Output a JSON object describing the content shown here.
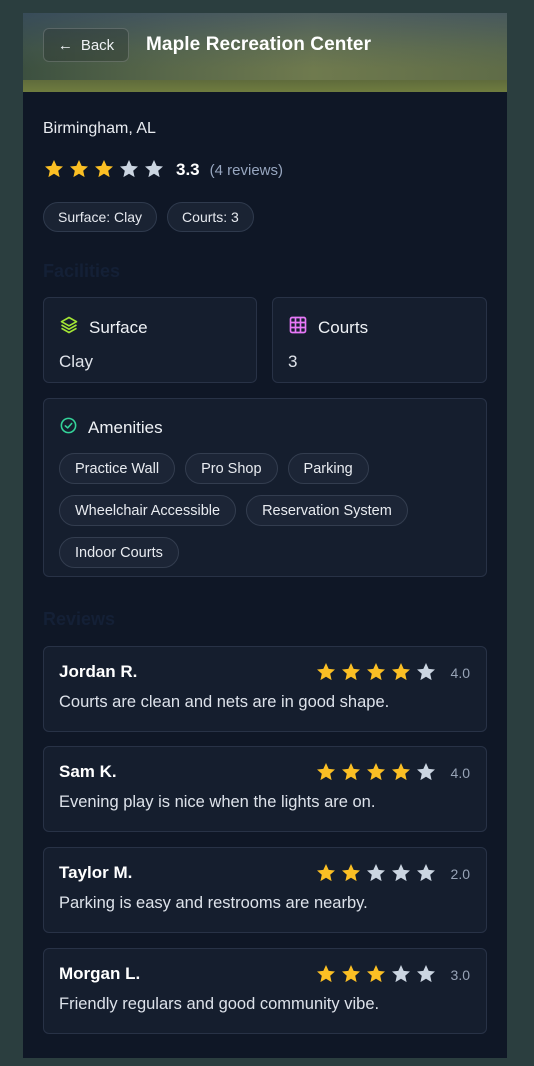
{
  "header": {
    "back_label": "Back",
    "back_arrow": "←",
    "title": "Maple Recreation Center"
  },
  "location": "Birmingham, AL",
  "rating": {
    "value": "3.3",
    "stars": 3.3,
    "count_text": "(4 reviews)"
  },
  "chips": [
    "Surface: Clay",
    "Courts: 3"
  ],
  "sections": {
    "facilities": "Facilities",
    "reviews": "Reviews"
  },
  "facilities": {
    "surface": {
      "label": "Surface",
      "value": "Clay",
      "icon": "layers-icon"
    },
    "courts": {
      "label": "Courts",
      "value": "3",
      "icon": "grid-icon"
    }
  },
  "amenities": {
    "label": "Amenities",
    "icon": "check-circle-icon",
    "items": [
      "Practice Wall",
      "Pro Shop",
      "Parking",
      "Wheelchair Accessible",
      "Reservation System",
      "Indoor Courts"
    ]
  },
  "reviews": [
    {
      "name": "Jordan R.",
      "rating": 4,
      "score": "4.0",
      "text": "Courts are clean and nets are in good shape."
    },
    {
      "name": "Sam K.",
      "rating": 4,
      "score": "4.0",
      "text": "Evening play is nice when the lights are on."
    },
    {
      "name": "Taylor M.",
      "rating": 2,
      "score": "2.0",
      "text": "Parking is easy and restrooms are nearby."
    },
    {
      "name": "Morgan L.",
      "rating": 3,
      "score": "3.0",
      "text": "Friendly regulars and good community vibe."
    }
  ],
  "colors": {
    "star_filled": "#fbbf24",
    "star_empty": "#cbd5e1",
    "accent_green": "#34d399",
    "accent_lime": "#a3e635",
    "accent_purple": "#e879f9"
  }
}
